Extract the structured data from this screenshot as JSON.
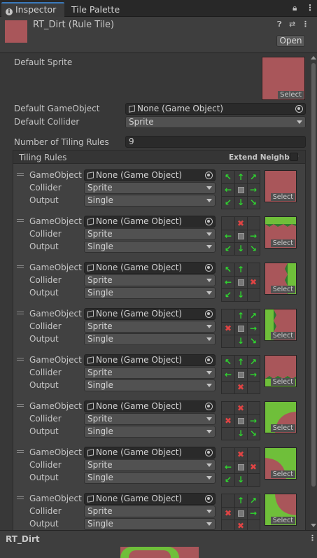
{
  "tabs": {
    "inspector": "Inspector",
    "palette": "Tile Palette"
  },
  "header": {
    "title": "RT_Dirt (Rule Tile)",
    "open_button": "Open"
  },
  "fields": {
    "default_sprite_label": "Default Sprite",
    "select_label": "Select",
    "default_gameobject_label": "Default GameObject",
    "default_gameobject_value": "None (Game Object)",
    "default_collider_label": "Default Collider",
    "default_collider_value": "Sprite",
    "tiling_rules_count_label": "Number of Tiling Rules",
    "tiling_rules_count_value": "9"
  },
  "tiling_rules": {
    "title": "Tiling Rules",
    "extend_neighbor_label": "Extend Neighbor",
    "row_labels": {
      "gameobject": "GameObject",
      "collider": "Collider",
      "output": "Output"
    },
    "rules": [
      {
        "gameobject": "None (Game Object)",
        "collider": "Sprite",
        "output": "Single",
        "neighbors": [
          "nw",
          "n",
          "ne",
          "w",
          "c",
          "e",
          "sw",
          "s",
          "se"
        ],
        "sprite": "full-dirt"
      },
      {
        "gameobject": "None (Game Object)",
        "collider": "Sprite",
        "output": "Single",
        "neighbors": [
          "_",
          "x",
          "_",
          "w",
          "c",
          "e",
          "sw",
          "s",
          "se"
        ],
        "sprite": "top-grass"
      },
      {
        "gameobject": "None (Game Object)",
        "collider": "Sprite",
        "output": "Single",
        "neighbors": [
          "nw",
          "n",
          "_",
          "w",
          "c",
          "x",
          "sw",
          "s",
          "_"
        ],
        "sprite": "right-grass"
      },
      {
        "gameobject": "None (Game Object)",
        "collider": "Sprite",
        "output": "Single",
        "neighbors": [
          "_",
          "n",
          "ne",
          "x",
          "c",
          "e",
          "_",
          "s",
          "se"
        ],
        "sprite": "left-grass"
      },
      {
        "gameobject": "None (Game Object)",
        "collider": "Sprite",
        "output": "Single",
        "neighbors": [
          "nw",
          "n",
          "ne",
          "w",
          "c",
          "e",
          "_",
          "x",
          "_"
        ],
        "sprite": "bottom-grass"
      },
      {
        "gameobject": "None (Game Object)",
        "collider": "Sprite",
        "output": "Single",
        "neighbors": [
          "_",
          "x",
          "_",
          "x",
          "c",
          "e",
          "_",
          "s",
          "se"
        ],
        "sprite": "corner-top-left"
      },
      {
        "gameobject": "None (Game Object)",
        "collider": "Sprite",
        "output": "Single",
        "neighbors": [
          "_",
          "x",
          "_",
          "w",
          "c",
          "x",
          "sw",
          "s",
          "_"
        ],
        "sprite": "corner-top-right"
      },
      {
        "gameobject": "None (Game Object)",
        "collider": "Sprite",
        "output": "Single",
        "neighbors": [
          "_",
          "n",
          "ne",
          "x",
          "c",
          "e",
          "_",
          "x",
          "_"
        ],
        "sprite": "corner-bottom-left"
      }
    ]
  },
  "footer": {
    "title": "RT_Dirt"
  },
  "colors": {
    "dirt": "#a9565a",
    "grass": "#6fbf3a",
    "grass_dark": "#2f7a2f",
    "accent": "#3a79bb"
  }
}
